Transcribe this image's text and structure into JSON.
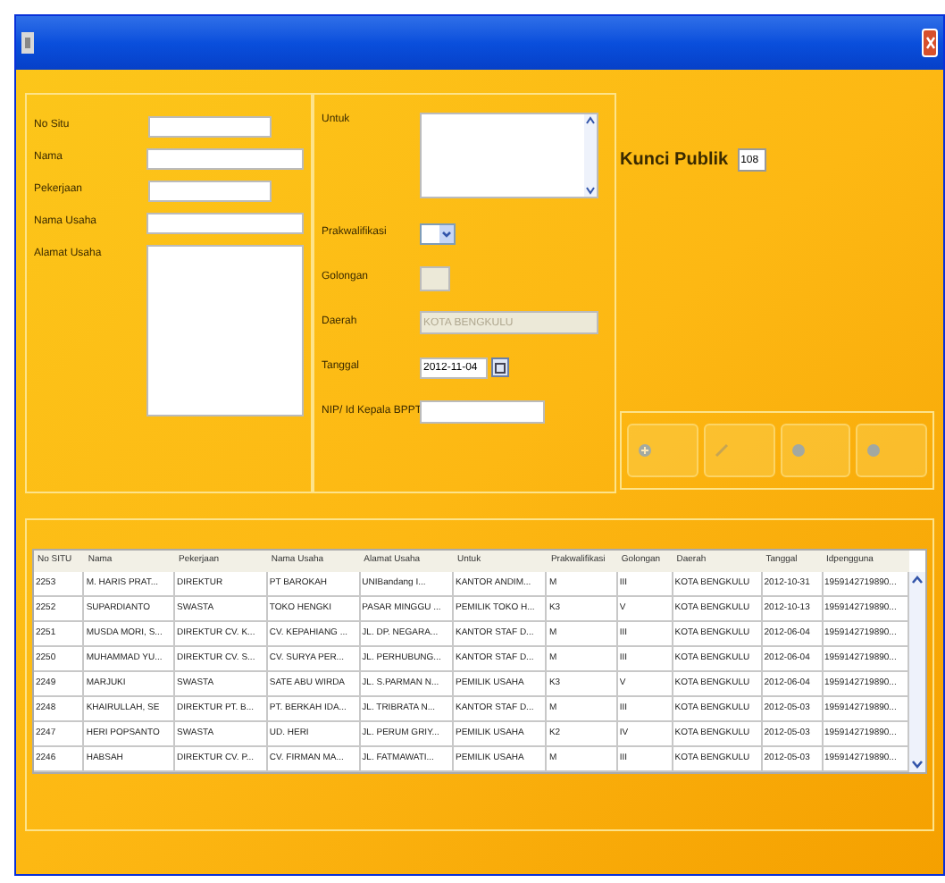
{
  "form_left": {
    "fields": [
      {
        "label": "No Situ",
        "kind": "text"
      },
      {
        "label": "Nama",
        "kind": "text"
      },
      {
        "label": "Pekerjaan",
        "kind": "text"
      },
      {
        "label": "Nama Usaha",
        "kind": "text"
      },
      {
        "label": "Alamat Usaha",
        "kind": "textarea"
      }
    ]
  },
  "form_middle": {
    "untuk": {
      "label": "Untuk"
    },
    "fields": [
      {
        "label": "Prakwalifikasi",
        "kind": "select",
        "disabled": false
      },
      {
        "label": "Golongan",
        "kind": "small",
        "disabled": true
      },
      {
        "label": "Daerah",
        "kind": "text",
        "value": "KOTA BENGKULU",
        "disabled": true
      },
      {
        "label": "Tanggal",
        "kind": "date",
        "value": "2012-11-04",
        "disabled": false
      },
      {
        "label": "NIP/ Id Kepala BPPT",
        "kind": "text",
        "disabled": false
      }
    ]
  },
  "kunci_publik": {
    "label": "Kunci Publik",
    "value": "108"
  },
  "buttons": [
    {
      "disabled": true
    },
    {
      "disabled": true
    },
    {
      "disabled": true
    },
    {
      "disabled": true
    }
  ],
  "table": {
    "columns": [
      "No SITU",
      "Nama",
      "Pekerjaan",
      "Nama Usaha",
      "Alamat Usaha",
      "Untuk",
      "Prakwalifikasi",
      "Golongan",
      "Daerah",
      "Tanggal",
      "Idpengguna"
    ],
    "rows": [
      [
        "2253",
        "M. HARIS PRAT...",
        "DIREKTUR",
        "PT BAROKAH",
        "UNIBandang I...",
        "KANTOR ANDIM...",
        "M",
        "III",
        "KOTA BENGKULU",
        "2012-10-31",
        "1959142719890..."
      ],
      [
        "2252",
        "SUPARDIANTO",
        "SWASTA",
        "TOKO HENGKI",
        "PASAR MINGGU ...",
        "PEMILIK TOKO H...",
        "K3",
        "V",
        "KOTA BENGKULU",
        "2012-10-13",
        "1959142719890..."
      ],
      [
        "2251",
        "MUSDA MORI, S...",
        "DIREKTUR CV. K...",
        "CV. KEPAHIANG ...",
        "JL. DP. NEGARA...",
        "KANTOR STAF D...",
        "M",
        "III",
        "KOTA BENGKULU",
        "2012-06-04",
        "1959142719890..."
      ],
      [
        "2250",
        "MUHAMMAD YU...",
        "DIREKTUR CV. S...",
        "CV. SURYA PER...",
        "JL. PERHUBUNG...",
        "KANTOR STAF D...",
        "M",
        "III",
        "KOTA BENGKULU",
        "2012-06-04",
        "1959142719890..."
      ],
      [
        "2249",
        "MARJUKI",
        "SWASTA",
        "SATE ABU WIRDA",
        "JL. S.PARMAN N...",
        "PEMILIK USAHA",
        "K3",
        "V",
        "KOTA BENGKULU",
        "2012-06-04",
        "1959142719890..."
      ],
      [
        "2248",
        "KHAIRULLAH, SE",
        "DIREKTUR PT. B...",
        "PT. BERKAH IDA...",
        "JL. TRIBRATA N...",
        "KANTOR STAF D...",
        "M",
        "III",
        "KOTA BENGKULU",
        "2012-05-03",
        "1959142719890..."
      ],
      [
        "2247",
        "HERI POPSANTO",
        "SWASTA",
        "UD. HERI",
        "JL. PERUM GRIY...",
        "PEMILIK USAHA",
        "K2",
        "IV",
        "KOTA BENGKULU",
        "2012-05-03",
        "1959142719890..."
      ],
      [
        "2246",
        "HABSAH",
        "DIREKTUR CV. P...",
        "CV. FIRMAN MA...",
        "JL. FATMAWATI...",
        "PEMILIK USAHA",
        "M",
        "III",
        "KOTA BENGKULU",
        "2012-05-03",
        "1959142719890..."
      ]
    ]
  }
}
